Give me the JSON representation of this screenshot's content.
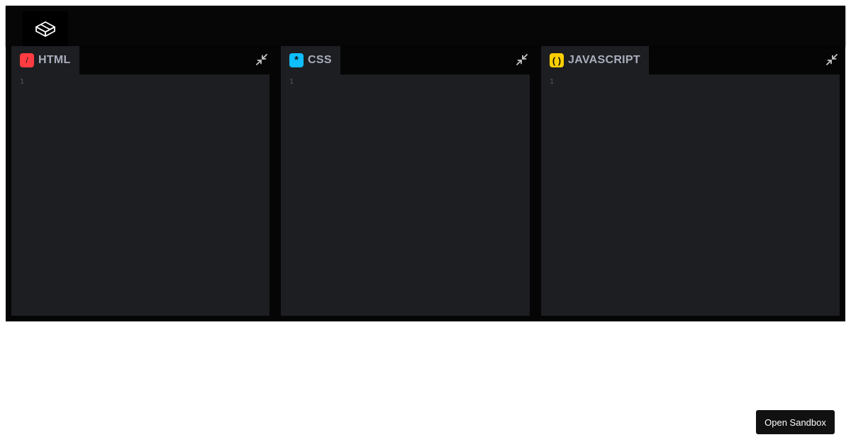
{
  "logo": {
    "icon": "codepen-cube-icon"
  },
  "panels": [
    {
      "id": "html",
      "badge": "/",
      "label": "HTML",
      "badge_color": "#ff3c41",
      "line_numbers": [
        "1"
      ],
      "collapse_icon": "minimize-arrows-icon"
    },
    {
      "id": "css",
      "badge": "*",
      "label": "CSS",
      "badge_color": "#0ebeff",
      "line_numbers": [
        "1"
      ],
      "collapse_icon": "minimize-arrows-icon"
    },
    {
      "id": "js",
      "badge": "( )",
      "label": "JAVASCRIPT",
      "badge_color": "#fcd000",
      "line_numbers": [
        "1"
      ],
      "collapse_icon": "minimize-arrows-icon"
    }
  ],
  "footer": {
    "open_sandbox_label": "Open Sandbox"
  },
  "colors": {
    "app_background": "#050505",
    "editor_background": "#1d1e22",
    "tab_text": "#aaaebc"
  }
}
